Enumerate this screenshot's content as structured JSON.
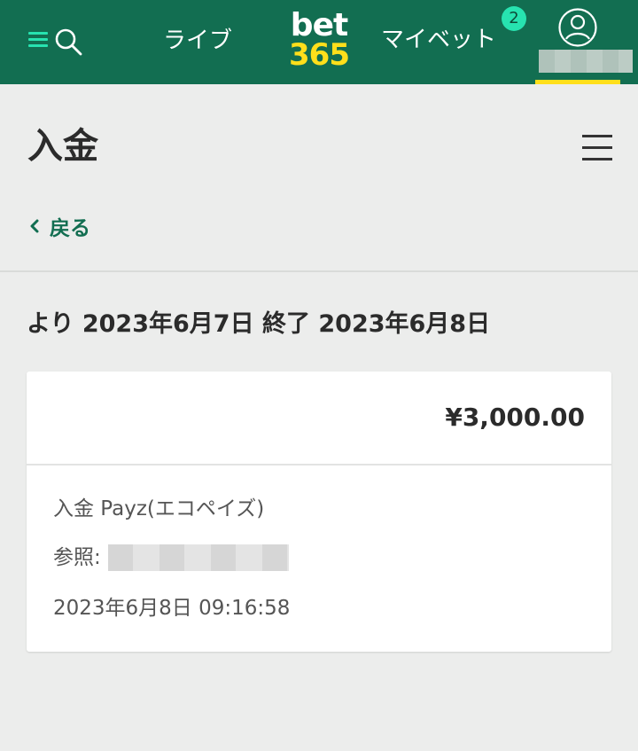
{
  "header": {
    "nav_live": "ライブ",
    "logo_top": "bet",
    "logo_bottom": "365",
    "nav_mybets": "マイベット",
    "mybets_badge": "2",
    "colors": {
      "bar": "#126e51",
      "accent": "#27e3b0",
      "logo_yellow": "#ffdf1b"
    }
  },
  "page": {
    "title": "入金",
    "back_label": "戻る"
  },
  "date_range": "より 2023年6月7日 終了 2023年6月8日",
  "transaction": {
    "amount": "¥3,000.00",
    "method": "入金 Payz(エコペイズ)",
    "reference_label": "参照:",
    "datetime": "2023年6月8日 09:16:58"
  },
  "icons": {
    "menu": "menu-icon",
    "search": "search-icon",
    "account": "account-icon",
    "hamburger": "hamburger-icon",
    "back": "chevron-left-icon"
  }
}
